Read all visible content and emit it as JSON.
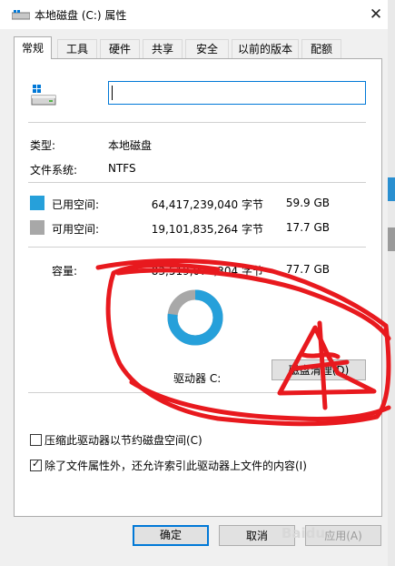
{
  "window": {
    "title": "本地磁盘 (C:) 属性",
    "close_glyph": "✕"
  },
  "tabs": [
    {
      "label": "常规",
      "active": true
    },
    {
      "label": "工具"
    },
    {
      "label": "硬件"
    },
    {
      "label": "共享"
    },
    {
      "label": "安全"
    },
    {
      "label": "以前的版本"
    },
    {
      "label": "配额"
    }
  ],
  "general": {
    "drive_name_value": "",
    "type_label": "类型:",
    "type_value": "本地磁盘",
    "fs_label": "文件系统:",
    "fs_value": "NTFS",
    "used_label": "已用空间:",
    "used_bytes": "64,417,239,040 字节",
    "used_gb": "59.9 GB",
    "free_label": "可用空间:",
    "free_bytes": "19,101,835,264 字节",
    "free_gb": "17.7 GB",
    "capacity_label": "容量:",
    "capacity_bytes": "83,519,074,304 字节",
    "capacity_gb": "77.7 GB",
    "drive_label": "驱动器 C:",
    "cleanup_button": "磁盘清理(D)",
    "used_fraction": 0.771,
    "compress_option": "压缩此驱动器以节约磁盘空间(C)",
    "compress_checked": false,
    "index_option": "除了文件属性外，还允许索引此驱动器上文件的内容(I)",
    "index_checked": true
  },
  "footer": {
    "ok": "确定",
    "cancel": "取消",
    "apply": "应用(A)"
  },
  "colors": {
    "used": "#26a0da",
    "free": "#a8a8a8",
    "accent": "#0078d7",
    "annotation": "#e8191e"
  },
  "watermark": "Baidu"
}
